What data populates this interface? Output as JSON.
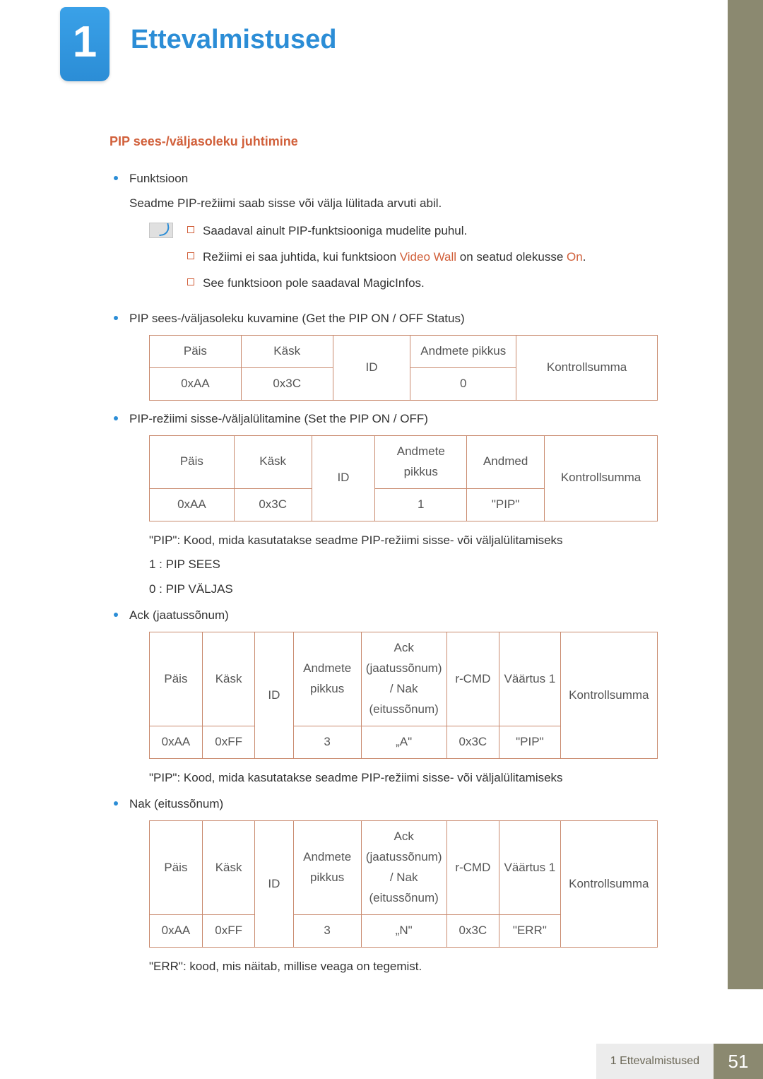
{
  "chapter": {
    "number": "1",
    "title": "Ettevalmistused"
  },
  "section": {
    "title": "PIP sees-/väljasoleku juhtimine"
  },
  "b1": {
    "title": "Funktsioon",
    "desc": "Seadme PIP-režiimi saab sisse või välja lülitada arvuti abil."
  },
  "notes": {
    "n1": "Saadaval ainult PIP-funktsiooniga mudelite puhul.",
    "n2a": "Režiimi ei saa juhtida, kui funktsioon ",
    "n2b": "Video Wall",
    "n2c": " on seatud olekusse ",
    "n2d": "On",
    "n2e": ".",
    "n3": "See funktsioon pole saadaval MagicInfos."
  },
  "b2": "PIP sees-/väljasoleku kuvamine (Get the PIP ON / OFF Status)",
  "b3": "PIP-režiimi sisse-/väljalülitamine (Set the PIP ON / OFF)",
  "b4": "Ack (jaatussõnum)",
  "b5": "Nak (eitussõnum)",
  "cols": {
    "pais": "Päis",
    "kask": "Käsk",
    "id": "ID",
    "andpik": "Andmete pikkus",
    "andmed": "Andmed",
    "ks": "Kontrollsumma",
    "ack": "Ack (jaatussõnum) / Nak (eitussõnum)",
    "rcmd": "r-CMD",
    "vaartus": "Väärtus 1"
  },
  "t1": {
    "r": [
      "0xAA",
      "0x3C",
      "",
      "0",
      ""
    ]
  },
  "t2": {
    "r": [
      "0xAA",
      "0x3C",
      "",
      "1",
      "\"PIP\"",
      ""
    ]
  },
  "t3": {
    "r": [
      "0xAA",
      "0xFF",
      "",
      "3",
      "„A\"",
      "0x3C",
      "\"PIP\"",
      ""
    ]
  },
  "t4": {
    "r": [
      "0xAA",
      "0xFF",
      "",
      "3",
      "„N\"",
      "0x3C",
      "\"ERR\"",
      ""
    ]
  },
  "after2": {
    "p1": "\"PIP\": Kood, mida kasutatakse seadme PIP-režiimi sisse- või väljalülitamiseks",
    "p2": "1 : PIP SEES",
    "p3": "0 : PIP VÄLJAS"
  },
  "after3": "\"PIP\": Kood, mida kasutatakse seadme PIP-režiimi sisse- või väljalülitamiseks",
  "after4": "\"ERR\": kood, mis näitab, millise veaga on tegemist.",
  "footer": {
    "label": "1 Ettevalmistused",
    "page": "51"
  }
}
